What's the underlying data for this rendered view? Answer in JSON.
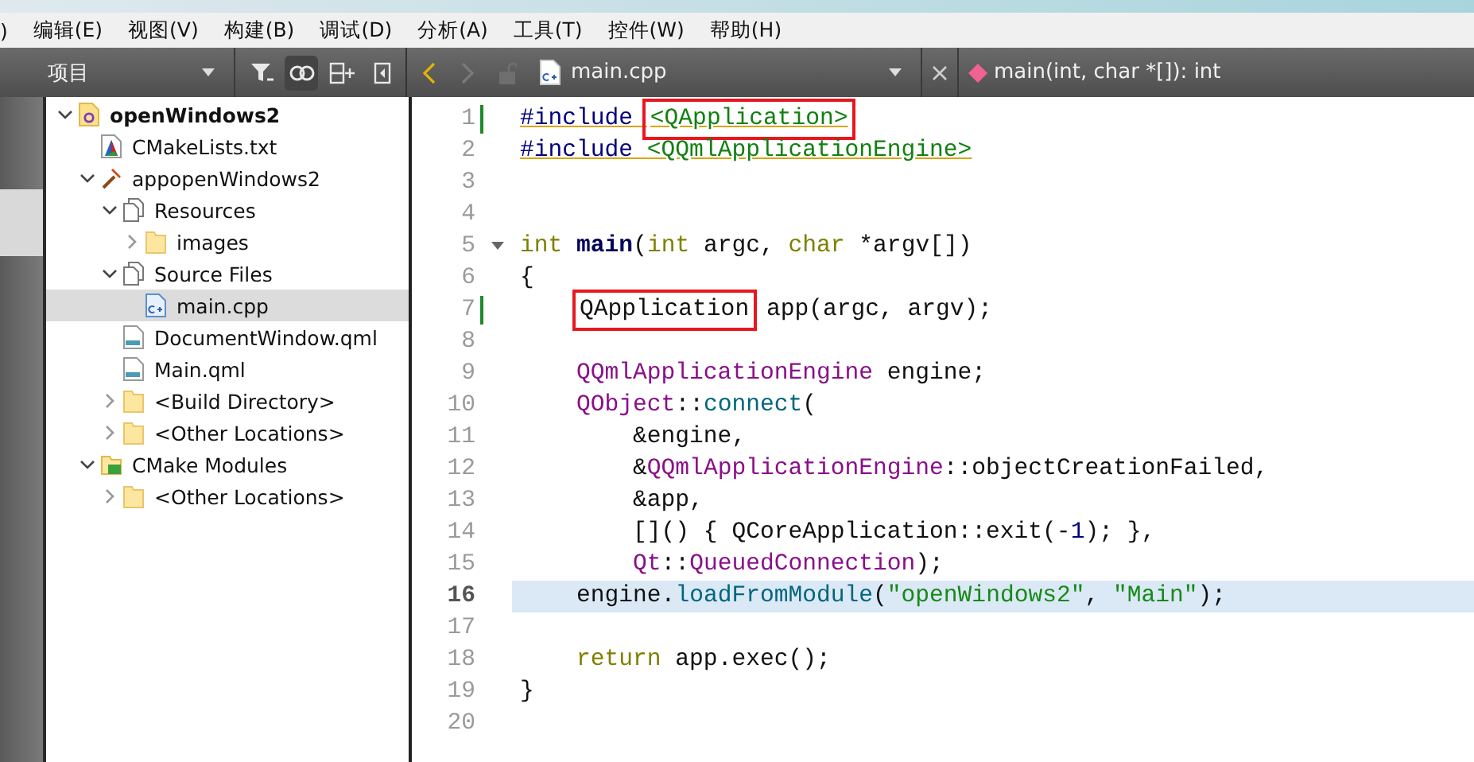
{
  "menu_bar": {
    "items": [
      ")",
      "编辑(E)",
      "视图(V)",
      "构建(B)",
      "调试(D)",
      "分析(A)",
      "工具(T)",
      "控件(W)",
      "帮助(H)"
    ]
  },
  "sidebar": {
    "title": "项目",
    "tree": [
      {
        "label": "openWindows2",
        "kind": "project",
        "expanded": true,
        "selected": false,
        "children": [
          {
            "label": "CMakeLists.txt",
            "kind": "cmake",
            "selected": false
          },
          {
            "label": "appopenWindows2",
            "kind": "target",
            "expanded": true,
            "selected": false,
            "children": [
              {
                "label": "Resources",
                "kind": "group",
                "expanded": true,
                "selected": false,
                "children": [
                  {
                    "label": "images",
                    "kind": "folder",
                    "expanded": false,
                    "selected": false
                  }
                ]
              },
              {
                "label": "Source Files",
                "kind": "group",
                "expanded": true,
                "selected": false,
                "children": [
                  {
                    "label": "main.cpp",
                    "kind": "cpp",
                    "selected": true
                  }
                ]
              },
              {
                "label": "DocumentWindow.qml",
                "kind": "qml",
                "selected": false
              },
              {
                "label": "Main.qml",
                "kind": "qml",
                "selected": false
              },
              {
                "label": "<Build Directory>",
                "kind": "folder",
                "expanded": false,
                "selected": false
              },
              {
                "label": "<Other Locations>",
                "kind": "folder",
                "expanded": false,
                "selected": false
              }
            ]
          },
          {
            "label": "CMake Modules",
            "kind": "modules",
            "expanded": true,
            "selected": false,
            "children": [
              {
                "label": "<Other Locations>",
                "kind": "folder",
                "expanded": false,
                "selected": false
              }
            ]
          }
        ]
      }
    ]
  },
  "editor": {
    "file": "main.cpp",
    "symbol": "main(int, char *[]): int",
    "lines": [
      {
        "number": "1",
        "modified": true,
        "current": false,
        "foldable": false,
        "indented": false,
        "tokens": [
          {
            "text": "#include ",
            "kind": "pre"
          },
          {
            "text": "<QApplication>",
            "kind": "inc",
            "boxed": true
          }
        ]
      },
      {
        "number": "2",
        "modified": false,
        "current": false,
        "foldable": false,
        "indented": false,
        "tokens": [
          {
            "text": "#include ",
            "kind": "pre"
          },
          {
            "text": "<QQmlApplicationEngine>",
            "kind": "inc"
          }
        ]
      },
      {
        "number": "3",
        "modified": false,
        "current": false,
        "foldable": false,
        "indented": false
      },
      {
        "number": "4",
        "modified": false,
        "current": false,
        "foldable": false,
        "indented": false
      },
      {
        "number": "5",
        "modified": false,
        "current": false,
        "foldable": true,
        "indented": false,
        "tokens": [
          {
            "text": "int ",
            "kind": "kw"
          },
          {
            "text": "main",
            "kind": "decl"
          },
          {
            "text": "(",
            "kind": "plain"
          },
          {
            "text": "int",
            "kind": "kw"
          },
          {
            "text": " argc, ",
            "kind": "plain"
          },
          {
            "text": "char",
            "kind": "kw"
          },
          {
            "text": " *argv[])",
            "kind": "plain"
          }
        ]
      },
      {
        "number": "6",
        "modified": false,
        "current": false,
        "foldable": false,
        "indented": false,
        "tokens": [
          {
            "text": "{",
            "kind": "plain"
          }
        ]
      },
      {
        "number": "7",
        "modified": true,
        "current": false,
        "foldable": false,
        "indented": true,
        "tokens": [
          {
            "text": "QApplication",
            "kind": "plain",
            "boxed": true
          },
          {
            "text": " app(argc, argv);",
            "kind": "plain"
          }
        ]
      },
      {
        "number": "8",
        "modified": false,
        "current": false,
        "foldable": false,
        "indented": false
      },
      {
        "number": "9",
        "modified": false,
        "current": false,
        "foldable": false,
        "indented": true,
        "tokens": [
          {
            "text": "QQmlApplicationEngine",
            "kind": "type"
          },
          {
            "text": " engine;",
            "kind": "plain"
          }
        ]
      },
      {
        "number": "10",
        "modified": false,
        "current": false,
        "foldable": false,
        "indented": true,
        "tokens": [
          {
            "text": "QObject",
            "kind": "type"
          },
          {
            "text": "::",
            "kind": "plain"
          },
          {
            "text": "connect",
            "kind": "func"
          },
          {
            "text": "(",
            "kind": "plain"
          }
        ]
      },
      {
        "number": "11",
        "modified": false,
        "current": false,
        "foldable": false,
        "indented": true,
        "tokens": [
          {
            "text": "    &engine,",
            "kind": "plain"
          }
        ]
      },
      {
        "number": "12",
        "modified": false,
        "current": false,
        "foldable": false,
        "indented": true,
        "tokens": [
          {
            "text": "    &",
            "kind": "plain"
          },
          {
            "text": "QQmlApplicationEngine",
            "kind": "type"
          },
          {
            "text": "::objectCreationFailed,",
            "kind": "plain"
          }
        ]
      },
      {
        "number": "13",
        "modified": false,
        "current": false,
        "foldable": false,
        "indented": true,
        "tokens": [
          {
            "text": "    &app,",
            "kind": "plain"
          }
        ]
      },
      {
        "number": "14",
        "modified": false,
        "current": false,
        "foldable": false,
        "indented": true,
        "tokens": [
          {
            "text": "    []() { QCoreApplication::exit(-",
            "kind": "plain"
          },
          {
            "text": "1",
            "kind": "num"
          },
          {
            "text": "); },",
            "kind": "plain"
          }
        ]
      },
      {
        "number": "15",
        "modified": false,
        "current": false,
        "foldable": false,
        "indented": true,
        "tokens": [
          {
            "text": "    Qt",
            "kind": "type"
          },
          {
            "text": "::",
            "kind": "plain"
          },
          {
            "text": "QueuedConnection",
            "kind": "type"
          },
          {
            "text": ");",
            "kind": "plain"
          }
        ]
      },
      {
        "number": "16",
        "modified": false,
        "current": true,
        "foldable": false,
        "indented": true,
        "tokens": [
          {
            "text": "engine.",
            "kind": "plain"
          },
          {
            "text": "loadFromModule",
            "kind": "func"
          },
          {
            "text": "(",
            "kind": "plain"
          },
          {
            "text": "\"openWindows2\"",
            "kind": "str"
          },
          {
            "text": ", ",
            "kind": "plain"
          },
          {
            "text": "\"Main\"",
            "kind": "str"
          },
          {
            "text": ");",
            "kind": "plain"
          }
        ]
      },
      {
        "number": "17",
        "modified": false,
        "current": false,
        "foldable": false,
        "indented": false
      },
      {
        "number": "18",
        "modified": false,
        "current": false,
        "foldable": false,
        "indented": true,
        "tokens": [
          {
            "text": "return",
            "kind": "kw"
          },
          {
            "text": " app.exec();",
            "kind": "plain"
          }
        ]
      },
      {
        "number": "19",
        "modified": false,
        "current": false,
        "foldable": false,
        "indented": false,
        "tokens": [
          {
            "text": "}",
            "kind": "plain"
          }
        ]
      },
      {
        "number": "20",
        "modified": false,
        "current": false,
        "foldable": false,
        "indented": false
      }
    ]
  }
}
